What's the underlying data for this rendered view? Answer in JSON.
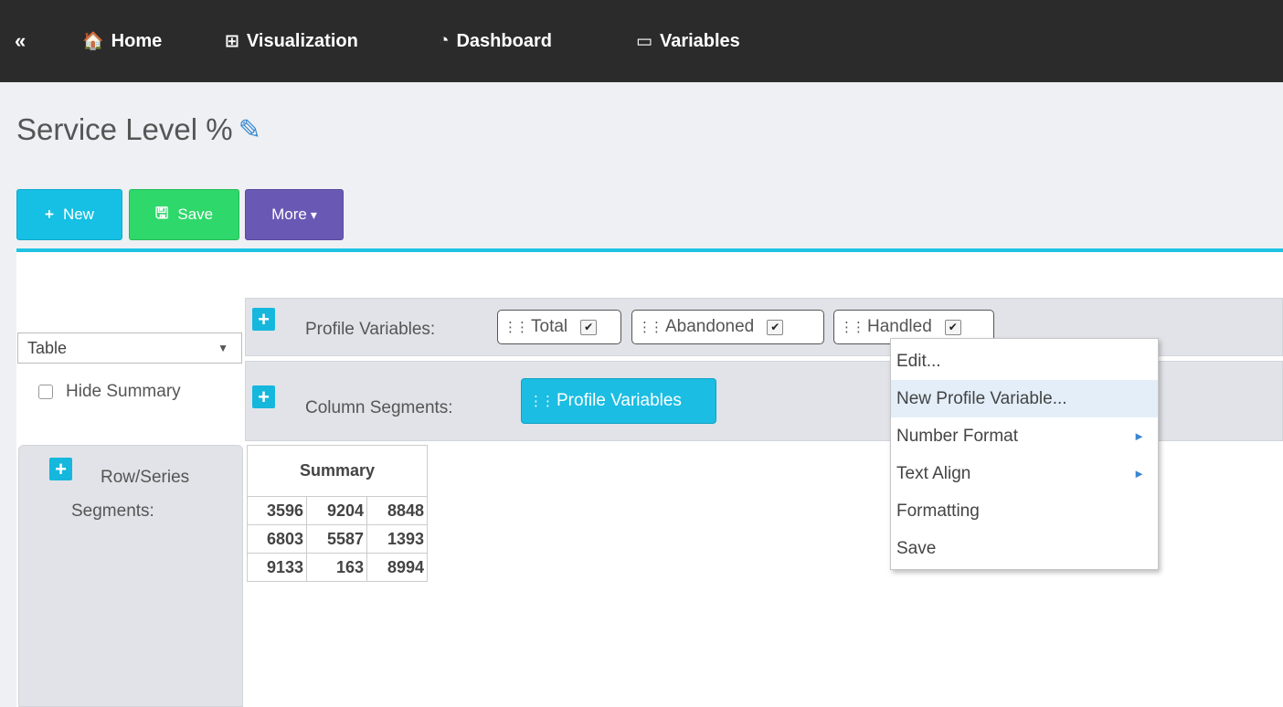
{
  "nav": {
    "collapse": "«",
    "items": [
      {
        "label": "Home",
        "icon": "home-icon",
        "glyph": "🏠"
      },
      {
        "label": "Visualization",
        "icon": "table-icon",
        "glyph": "⊞"
      },
      {
        "label": "Dashboard",
        "icon": "dashboard-icon",
        "glyph": "◔"
      },
      {
        "label": "Variables",
        "icon": "monitor-icon",
        "glyph": "▭"
      }
    ]
  },
  "page": {
    "title": "Service Level %",
    "edit_icon": "pencil-icon"
  },
  "toolbar": {
    "new_label": "New",
    "save_label": "Save",
    "more_label": "More",
    "more_caret": "▾",
    "new_glyph": "+",
    "save_glyph": "🖫"
  },
  "view": {
    "type": "Table",
    "caret": "▼",
    "hide_summary_label": "Hide Summary",
    "hide_summary_checked": false
  },
  "zones": {
    "profile_label": "Profile Variables:",
    "column_label": "Column Segments:",
    "row_label_1": "Row/Series",
    "row_label_2": "Segments:",
    "plus": "+"
  },
  "profile_variables": [
    {
      "label": "Total",
      "checked": true
    },
    {
      "label": "Abandoned",
      "checked": true
    },
    {
      "label": "Handled",
      "checked": true
    }
  ],
  "column_segments": [
    {
      "label": "Profile Variables"
    }
  ],
  "summary": {
    "header": "Summary",
    "rows": [
      [
        "3596",
        "9204",
        "8848"
      ],
      [
        "6803",
        "5587",
        "1393"
      ],
      [
        "9133",
        "163",
        "8994"
      ]
    ]
  },
  "context_menu": {
    "items": [
      {
        "label": "Edit...",
        "submenu": false,
        "highlighted": false
      },
      {
        "label": "New Profile Variable...",
        "submenu": false,
        "highlighted": true
      },
      {
        "label": "Number Format",
        "submenu": true,
        "highlighted": false
      },
      {
        "label": "Text Align",
        "submenu": true,
        "highlighted": false
      },
      {
        "label": "Formatting",
        "submenu": false,
        "highlighted": false
      },
      {
        "label": "Save",
        "submenu": false,
        "highlighted": false
      }
    ],
    "submenu_arrow": "►"
  },
  "colors": {
    "nav_bg": "#2b2b2b",
    "new_btn": "#15c0e4",
    "save_btn": "#2ed86a",
    "more_btn": "#6a58b5",
    "accent_line": "#1fc2e3",
    "chip_active": "#1bbde2",
    "menu_highlight": "#e3eef8"
  }
}
